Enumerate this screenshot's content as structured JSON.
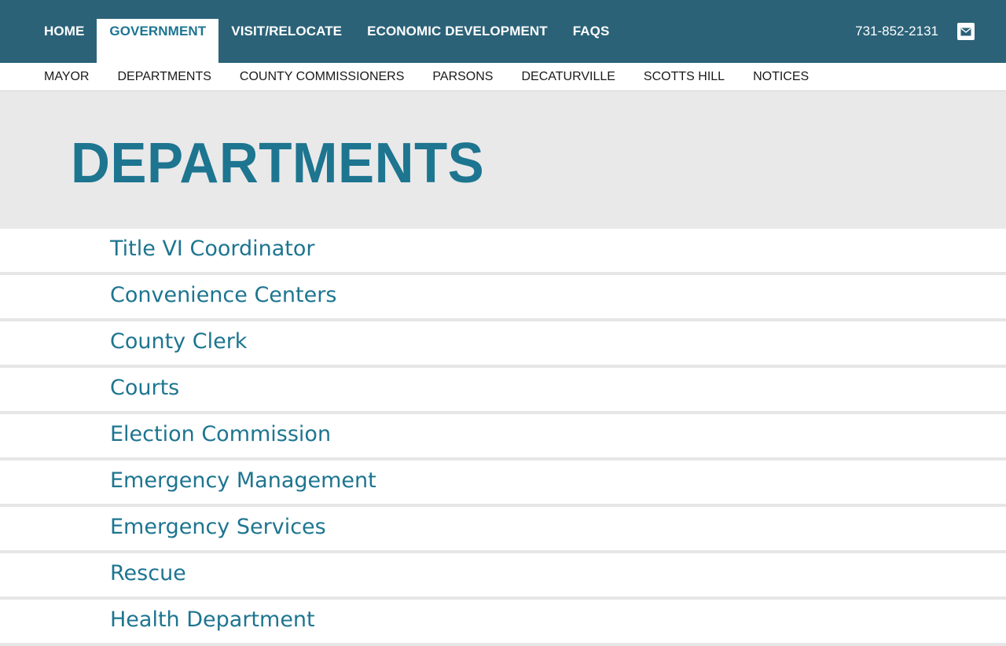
{
  "top_nav": {
    "items": [
      {
        "label": "HOME",
        "active": false
      },
      {
        "label": "GOVERNMENT",
        "active": true
      },
      {
        "label": "VISIT/RELOCATE",
        "active": false
      },
      {
        "label": "ECONOMIC DEVELOPMENT",
        "active": false
      },
      {
        "label": "FAQS",
        "active": false
      }
    ],
    "phone": "731-852-2131",
    "mail_icon": "mail-icon"
  },
  "sub_nav": {
    "items": [
      "MAYOR",
      "DEPARTMENTS",
      "COUNTY COMMISSIONERS",
      "PARSONS",
      "DECATURVILLE",
      "SCOTTS HILL",
      "NOTICES"
    ]
  },
  "hero": {
    "title": "DEPARTMENTS"
  },
  "departments": [
    "Title VI Coordinator",
    "Convenience Centers",
    "County Clerk",
    "Courts",
    "Election Commission",
    "Emergency Management",
    "Emergency Services",
    "Rescue",
    "Health Department"
  ],
  "colors": {
    "nav_bg": "#2b6278",
    "accent": "#1d7590",
    "hero_bg": "#e9e9e9"
  }
}
